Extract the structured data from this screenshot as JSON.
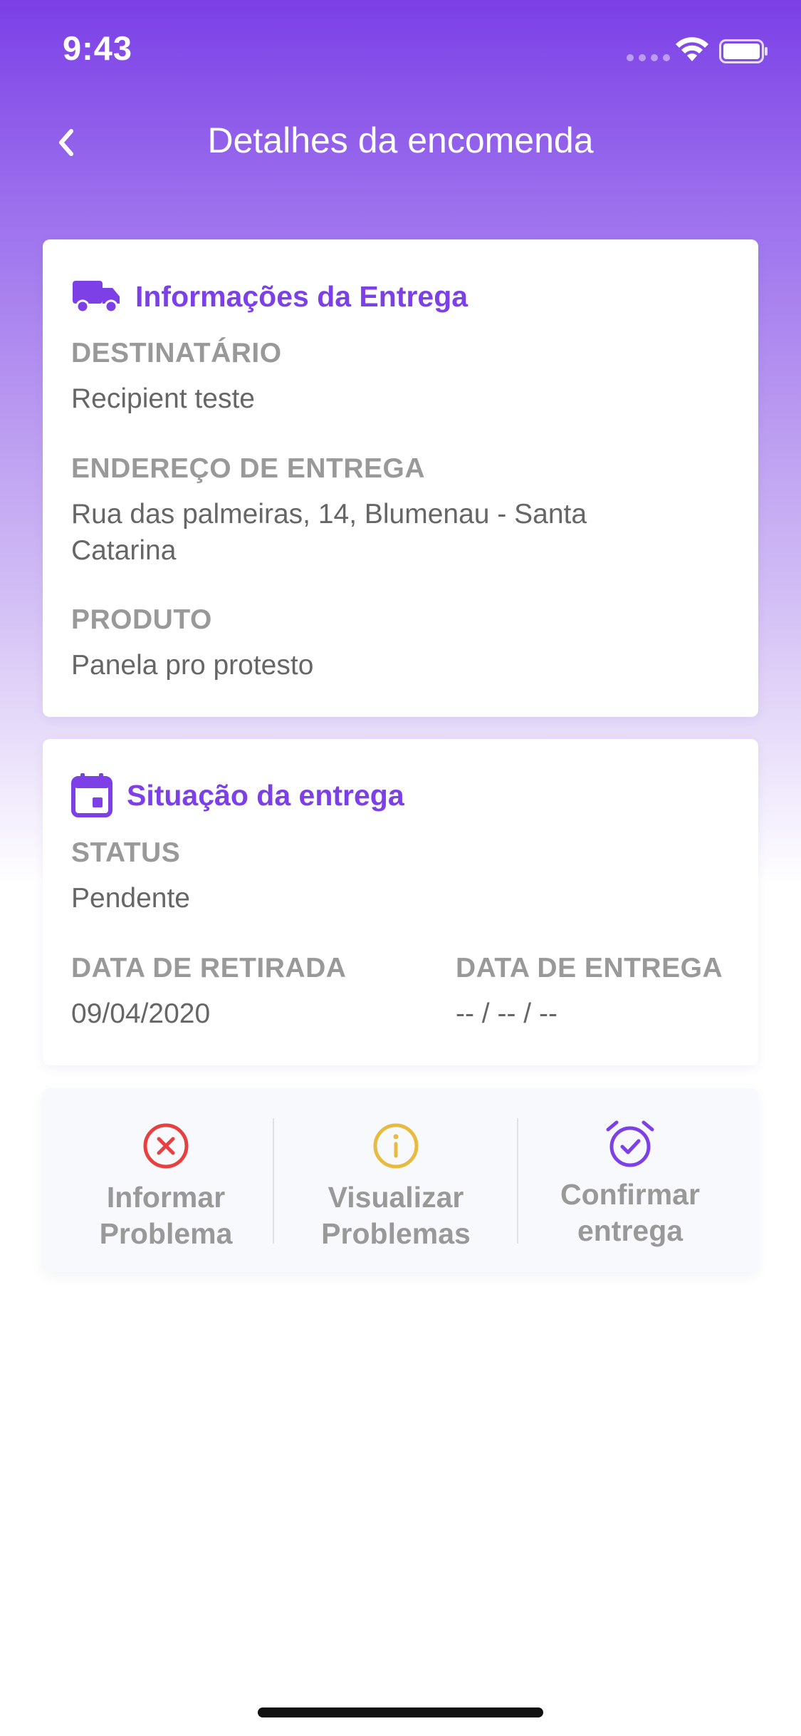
{
  "status_bar": {
    "time": "9:43"
  },
  "nav": {
    "title": "Detalhes da encomenda"
  },
  "delivery_info": {
    "title": "Informações da Entrega",
    "recipient_label": "DESTINATÁRIO",
    "recipient_value": "Recipient teste",
    "address_label": "ENDEREÇO DE ENTREGA",
    "address_line1": "Rua das palmeiras, 14, Blumenau - Santa",
    "address_line2": "Catarina",
    "product_label": "PRODUTO",
    "product_value": "Panela pro protesto"
  },
  "delivery_status": {
    "title": "Situação da entrega",
    "status_label": "STATUS",
    "status_value": "Pendente",
    "pickup_label": "DATA DE RETIRADA",
    "pickup_value": "09/04/2020",
    "delivery_label": "DATA DE ENTREGA",
    "delivery_value": "-- / -- / --"
  },
  "actions": [
    {
      "line1": "Informar",
      "line2": "Problema",
      "icon": "x-circle-icon",
      "color": "#e74040"
    },
    {
      "line1": "Visualizar",
      "line2": "Problemas",
      "icon": "info-circle-icon",
      "color": "#e7ba40"
    },
    {
      "line1": "Confirmar",
      "line2": "entrega",
      "icon": "alarm-check-icon",
      "color": "#7d40e7"
    }
  ],
  "colors": {
    "accent": "#7d40e7",
    "label": "#999999",
    "value": "#666666"
  }
}
